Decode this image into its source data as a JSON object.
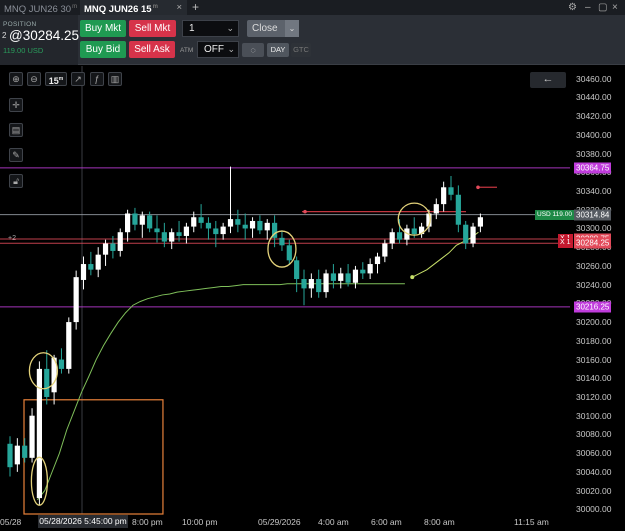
{
  "tabs": {
    "inactive": {
      "label": "MNQ JUN26 30",
      "sup": "m"
    },
    "active": {
      "label": "MNQ JUN26 15",
      "sup": "m",
      "close": "×"
    },
    "add": "+"
  },
  "window_controls": {
    "gear": "⚙",
    "minimize": "–",
    "maximize": "▢",
    "close": "×"
  },
  "position": {
    "label": "POSITION",
    "qty": "2",
    "price": "@30284.25",
    "pnl": "119.00 USD"
  },
  "order_buttons": {
    "buy_mkt": "Buy Mkt",
    "sell_mkt": "Sell Mkt",
    "buy_bid": "Buy Bid",
    "sell_ask": "Sell Ask",
    "quantity": "1",
    "close": "Close",
    "atm_label": "ATM",
    "atm_value": "OFF",
    "tif_day": "DAY",
    "tif_gtc": "GTC"
  },
  "chart_toolbar": {
    "timeframe": "15",
    "timeframe_sup": "m",
    "back": "←"
  },
  "colors": {
    "bull": "#ffffff",
    "bear": "#26a69a",
    "green_btn": "#1f9a52",
    "red_btn": "#d6334a",
    "ma": "#7fbf5a",
    "box": "#e8813a",
    "circle": "#e3d27a",
    "purple": "#c03cdc",
    "pos_line": "#e24a5a"
  },
  "chart_data": {
    "type": "candlestick",
    "symbol": "MNQ JUN26",
    "interval": "15m",
    "ylim": [
      29995,
      30465
    ],
    "y_ticks": [
      30460,
      30440,
      30420,
      30400,
      30380,
      30360,
      30340,
      30320,
      30300,
      30280,
      30260,
      30240,
      30220,
      30200,
      30180,
      30160,
      30140,
      30120,
      30100,
      30080,
      30060,
      30040,
      30020,
      30000
    ],
    "x_labels": [
      "05/28",
      "8:00 pm",
      "10:00 pm",
      "05/29/2026",
      "4:00 am",
      "6:00 am",
      "8:00 am",
      "11:15 am"
    ],
    "cursor_time": "05/28/2026 5:45:00 pm",
    "price_tags": [
      {
        "value": 30364.75,
        "label": "30364.75",
        "color": "#c03cdc"
      },
      {
        "value": 30314.84,
        "label": "30314.84",
        "color": "#555a61"
      },
      {
        "value": 30288.75,
        "label": "30288.75",
        "color": "#e24a5a"
      },
      {
        "value": 30284.25,
        "label": "30284.25",
        "color": "#e24a5a"
      },
      {
        "value": 30216.25,
        "label": "30216.25",
        "color": "#c03cdc"
      }
    ],
    "position_tag": {
      "label": "USD 119.00",
      "value": 30314.84
    },
    "order_marks": [
      {
        "value": 30288.75,
        "label": "X 1"
      },
      {
        "value": 30284.25,
        "label": "X 1"
      }
    ],
    "position_qty_marker": "+2",
    "candles": [
      [
        30070,
        30078,
        30035,
        30045
      ],
      [
        30048,
        30076,
        30040,
        30068
      ],
      [
        30068,
        30076,
        30050,
        30055
      ],
      [
        30055,
        30108,
        30050,
        30100
      ],
      [
        30012,
        30158,
        30005,
        30150
      ],
      [
        30150,
        30170,
        30112,
        30120
      ],
      [
        30125,
        30165,
        30112,
        30162
      ],
      [
        30160,
        30172,
        30145,
        30150
      ],
      [
        30150,
        30205,
        30145,
        30200
      ],
      [
        30200,
        30255,
        30192,
        30248
      ],
      [
        30245,
        30270,
        30235,
        30262
      ],
      [
        30262,
        30275,
        30250,
        30256
      ],
      [
        30256,
        30280,
        30248,
        30272
      ],
      [
        30272,
        30288,
        30260,
        30284
      ],
      [
        30284,
        30292,
        30268,
        30276
      ],
      [
        30276,
        30300,
        30270,
        30296
      ],
      [
        30296,
        30320,
        30286,
        30316
      ],
      [
        30316,
        30322,
        30298,
        30304
      ],
      [
        30304,
        30318,
        30290,
        30314
      ],
      [
        30314,
        30318,
        30296,
        30300
      ],
      [
        30300,
        30314,
        30285,
        30296
      ],
      [
        30296,
        30306,
        30280,
        30286
      ],
      [
        30286,
        30300,
        30278,
        30296
      ],
      [
        30296,
        30308,
        30286,
        30292
      ],
      [
        30292,
        30306,
        30284,
        30302
      ],
      [
        30302,
        30318,
        30296,
        30312
      ],
      [
        30312,
        30326,
        30300,
        30306
      ],
      [
        30306,
        30312,
        30288,
        30300
      ],
      [
        30300,
        30308,
        30280,
        30294
      ],
      [
        30294,
        30306,
        30288,
        30302
      ],
      [
        30302,
        30366,
        30295,
        30310
      ],
      [
        30310,
        30320,
        30296,
        30304
      ],
      [
        30304,
        30316,
        30288,
        30300
      ],
      [
        30300,
        30312,
        30290,
        30308
      ],
      [
        30308,
        30314,
        30294,
        30298
      ],
      [
        30298,
        30310,
        30288,
        30306
      ],
      [
        30306,
        30314,
        30280,
        30290
      ],
      [
        30290,
        30298,
        30276,
        30282
      ],
      [
        30282,
        30288,
        30262,
        30266
      ],
      [
        30266,
        30270,
        30232,
        30246
      ],
      [
        30246,
        30256,
        30218,
        30236
      ],
      [
        30236,
        30252,
        30226,
        30246
      ],
      [
        30246,
        30256,
        30226,
        30232
      ],
      [
        30232,
        30256,
        30226,
        30252
      ],
      [
        30252,
        30262,
        30236,
        30244
      ],
      [
        30244,
        30258,
        30236,
        30252
      ],
      [
        30252,
        30262,
        30238,
        30242
      ],
      [
        30242,
        30260,
        30236,
        30256
      ],
      [
        30256,
        30264,
        30246,
        30252
      ],
      [
        30252,
        30268,
        30246,
        30262
      ],
      [
        30262,
        30274,
        30252,
        30270
      ],
      [
        30270,
        30288,
        30264,
        30284
      ],
      [
        30284,
        30300,
        30278,
        30296
      ],
      [
        30296,
        30310,
        30284,
        30288
      ],
      [
        30288,
        30304,
        30282,
        30300
      ],
      [
        30300,
        30312,
        30290,
        30294
      ],
      [
        30294,
        30306,
        30290,
        30302
      ],
      [
        30302,
        30320,
        30296,
        30316
      ],
      [
        30316,
        30332,
        30310,
        30326
      ],
      [
        30326,
        30350,
        30318,
        30344
      ],
      [
        30344,
        30356,
        30330,
        30336
      ],
      [
        30336,
        30346,
        30296,
        30304
      ],
      [
        30304,
        30308,
        30278,
        30284
      ],
      [
        30284,
        30306,
        30280,
        30302
      ],
      [
        30302,
        30316,
        30296,
        30312
      ]
    ],
    "ma_line": [
      [
        30010,
        30020,
        30040,
        30060,
        30085,
        30105,
        30125,
        30142,
        30160,
        30175,
        30188,
        30200,
        30210,
        30218,
        30222,
        30225,
        30227,
        30229,
        30230,
        30232,
        30233,
        30234,
        30235,
        30236,
        30237,
        30238,
        30238,
        30239,
        30240,
        30240,
        30240,
        30240,
        30240,
        30240,
        30241,
        30241,
        30241,
        30241,
        30241,
        30241,
        30241,
        30241,
        30241,
        30241,
        30241,
        30241,
        30241,
        30241,
        30241,
        30241,
        30241
      ]
    ],
    "ma2_line": [
      30248,
      30252,
      30256,
      30262,
      30268,
      30274,
      30282,
      30286,
      30290,
      30296
    ],
    "boxes": [
      {
        "from_candle": 0,
        "to_candle": 17,
        "top": 30117,
        "bottom": 29995
      }
    ],
    "circles": [
      {
        "candle": 4,
        "value": 30148,
        "label": ""
      },
      {
        "candle": 4,
        "value": 30030,
        "label": ""
      },
      {
        "candle": 37,
        "value": 30278,
        "label": ""
      },
      {
        "candle": 55,
        "value": 30310,
        "label": ""
      }
    ],
    "h_lines": [
      {
        "value": 30364.75,
        "color": "#c03cdc"
      },
      {
        "value": 30314.84,
        "color": "#9aa0a8"
      },
      {
        "value": 30288.75,
        "color": "#e24a5a"
      },
      {
        "value": 30284.25,
        "color": "#e24a5a"
      },
      {
        "value": 30216.25,
        "color": "#c03cdc"
      }
    ]
  }
}
